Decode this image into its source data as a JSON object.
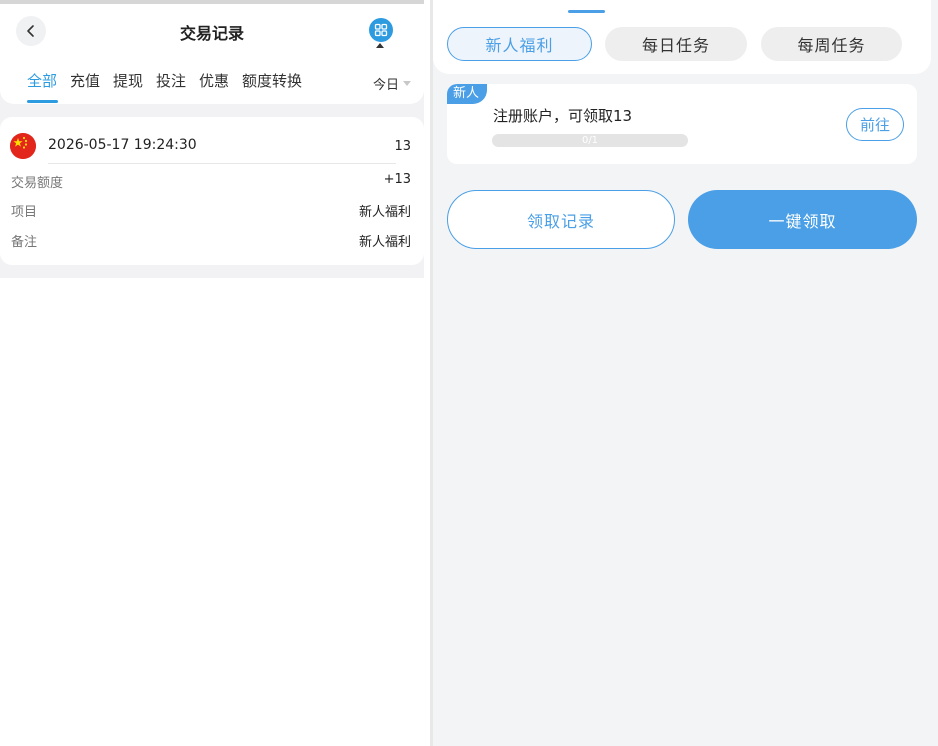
{
  "left_panel": {
    "header": {
      "title": "交易记录",
      "back_icon": "chevron-left-icon",
      "menu_icon": "grid-icon"
    },
    "tabs": [
      {
        "label": "全部",
        "active": true
      },
      {
        "label": "充值",
        "active": false
      },
      {
        "label": "提现",
        "active": false
      },
      {
        "label": "投注",
        "active": false
      },
      {
        "label": "优惠",
        "active": false
      },
      {
        "label": "额度转换",
        "active": false
      }
    ],
    "date_filter": "今日",
    "record": {
      "flag_icon": "china-flag-icon",
      "time": "2026-05-17 19:24:30",
      "amount": "13",
      "rows": [
        {
          "key": "交易额度",
          "value": "+13"
        },
        {
          "key": "项目",
          "value": "新人福利"
        },
        {
          "key": "备注",
          "value": "新人福利"
        }
      ]
    }
  },
  "right_panel": {
    "segments": [
      {
        "label": "新人福利",
        "active": true
      },
      {
        "label": "每日任务",
        "active": false
      },
      {
        "label": "每周任务",
        "active": false
      }
    ],
    "task": {
      "badge": "新人",
      "title": "注册账户，可领取13",
      "progress_text": "0/1",
      "progress": 0,
      "go_button": "前往"
    },
    "buttons": {
      "records": "领取记录",
      "claim_all": "一键领取"
    }
  },
  "colors": {
    "accent": "#2d9be0",
    "primary_button": "#4a9fe6",
    "flag_red": "#e2261c",
    "flag_star": "#ffde00"
  }
}
